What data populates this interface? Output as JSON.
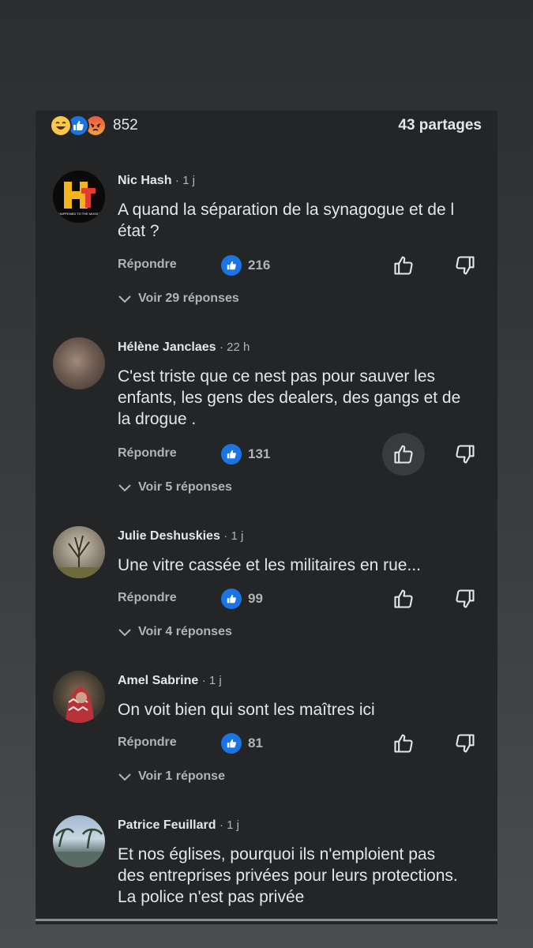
{
  "summary": {
    "reaction_icons": [
      "haha-emoji-icon",
      "like-icon",
      "angry-emoji-icon"
    ],
    "reaction_count": "852",
    "shares": "43 partages"
  },
  "comments": [
    {
      "author": "Nic Hash",
      "time": "· 1 j",
      "text_lines": [
        "A quand la séparation de la synagogue et de l",
        "état ?"
      ],
      "reply": "Répondre",
      "likes": "216",
      "view_replies": "Voir 29 réponses",
      "avatar_logo_text": "HAPPENED TO THE MUSIC"
    },
    {
      "author": "Hélène Janclaes",
      "time": "· 22 h",
      "text_lines": [
        "C'est triste que ce nest pas pour sauver les",
        "enfants, les gens des dealers, des gangs et de",
        "la drogue ."
      ],
      "reply": "Répondre",
      "likes": "131",
      "view_replies": "Voir 5 réponses"
    },
    {
      "author": "Julie Deshuskies",
      "time": "· 1 j",
      "text_lines": [
        "Une vitre cassée et les militaires en rue..."
      ],
      "reply": "Répondre",
      "likes": "99",
      "view_replies": "Voir 4 réponses"
    },
    {
      "author": "Amel Sabrine",
      "time": "· 1 j",
      "text_lines": [
        "On voit bien qui sont les maîtres ici"
      ],
      "reply": "Répondre",
      "likes": "81",
      "view_replies": "Voir 1 réponse"
    },
    {
      "author": "Patrice Feuillard",
      "time": "· 1 j",
      "text_lines": [
        "Et nos églises, pourquoi ils n'emploient pas",
        "des entreprises privées pour leurs protections.",
        "La police n'est pas privée"
      ]
    }
  ],
  "colors": {
    "like_blue": "#1b74e4",
    "panel_bg": "#242526",
    "muted_text": "#b0b3b8"
  }
}
